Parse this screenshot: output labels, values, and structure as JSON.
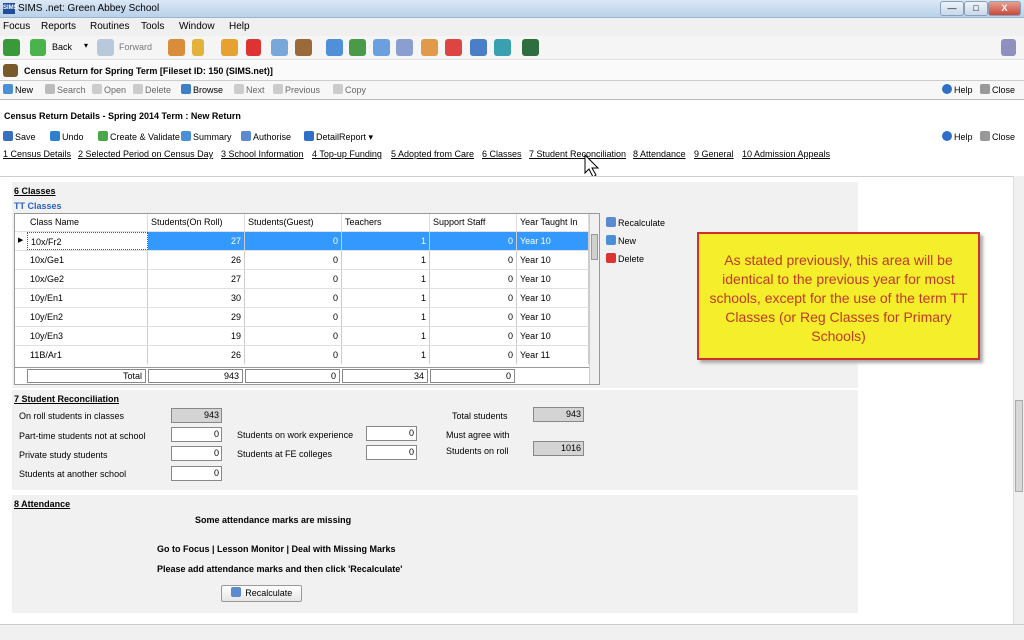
{
  "window": {
    "title": "SIMS .net: Green Abbey School",
    "app_icon": "SIMS",
    "buttons": [
      "—",
      "□",
      "X"
    ]
  },
  "menu": [
    "Focus",
    "Reports",
    "Routines",
    "Tools",
    "Window",
    "Help"
  ],
  "toolbar": {
    "back": "Back",
    "forward": "Forward"
  },
  "census": {
    "title": "Census Return for Spring Term [Fileset ID:  150 (SIMS.net)]"
  },
  "ops": {
    "new": "New",
    "search": "Search",
    "open": "Open",
    "delete": "Delete",
    "browse": "Browse",
    "next": "Next",
    "previous": "Previous",
    "copy": "Copy",
    "help": "Help",
    "close": "Close"
  },
  "detail": {
    "title": "Census Return Details - Spring 2014 Term : New Return",
    "save": "Save",
    "undo": "Undo",
    "create_validate": "Create & Validate",
    "summary": "Summary",
    "authorise": "Authorise",
    "detail_report": "DetailReport",
    "help": "Help",
    "close": "Close"
  },
  "tabs": [
    "1 Census Details",
    "2 Selected Period on Census Day",
    "3 School Information",
    "4 Top-up Funding",
    "5 Adopted from Care",
    "6 Classes",
    "7 Student Reconciliation",
    "8 Attendance",
    "9 General",
    "10 Admission Appeals"
  ],
  "classes": {
    "heading": "6 Classes",
    "subheading": "TT Classes",
    "columns": [
      "Class Name",
      "Students(On Roll)",
      "Students(Guest)",
      "Teachers",
      "Support Staff",
      "Year Taught In"
    ],
    "rows": [
      {
        "name": "10x/Fr2",
        "on_roll": "27",
        "guest": "0",
        "teachers": "1",
        "support": "0",
        "year": "Year 10"
      },
      {
        "name": "10x/Ge1",
        "on_roll": "26",
        "guest": "0",
        "teachers": "1",
        "support": "0",
        "year": "Year 10"
      },
      {
        "name": "10x/Ge2",
        "on_roll": "27",
        "guest": "0",
        "teachers": "1",
        "support": "0",
        "year": "Year 10"
      },
      {
        "name": "10y/En1",
        "on_roll": "30",
        "guest": "0",
        "teachers": "1",
        "support": "0",
        "year": "Year 10"
      },
      {
        "name": "10y/En2",
        "on_roll": "29",
        "guest": "0",
        "teachers": "1",
        "support": "0",
        "year": "Year 10"
      },
      {
        "name": "10y/En3",
        "on_roll": "19",
        "guest": "0",
        "teachers": "1",
        "support": "0",
        "year": "Year 10"
      },
      {
        "name": "11B/Ar1",
        "on_roll": "26",
        "guest": "0",
        "teachers": "1",
        "support": "0",
        "year": "Year 11"
      }
    ],
    "total_label": "Total",
    "totals": {
      "on_roll": "943",
      "guest": "0",
      "teachers": "34",
      "support": "0"
    },
    "recalculate": "Recalculate",
    "new": "New",
    "delete": "Delete"
  },
  "callout": "As stated previously, this area will be identical to the previous year for most schools, except for the use of the term TT Classes (or Reg Classes for Primary Schools)",
  "reconciliation": {
    "heading": "7 Student Reconciliation",
    "on_roll_label": "On roll students in classes",
    "on_roll": "943",
    "part_time_label": "Part-time students not at school",
    "part_time": "0",
    "private_label": "Private study students",
    "private": "0",
    "another_label": "Students at another school",
    "another": "0",
    "work_label": "Students on work experience",
    "work": "0",
    "fe_label": "Students at FE colleges",
    "fe": "0",
    "total_label": "Total students",
    "total": "943",
    "must_agree_label": "Must agree with",
    "students_roll_label": "Students on roll",
    "students_roll": "1016"
  },
  "attendance": {
    "heading": "8 Attendance",
    "missing": "Some attendance marks are missing",
    "goto": "Go to Focus | Lesson Monitor | Deal with Missing Marks",
    "please": "Please add attendance marks and then click 'Recalculate'",
    "recalculate": "Recalculate"
  }
}
